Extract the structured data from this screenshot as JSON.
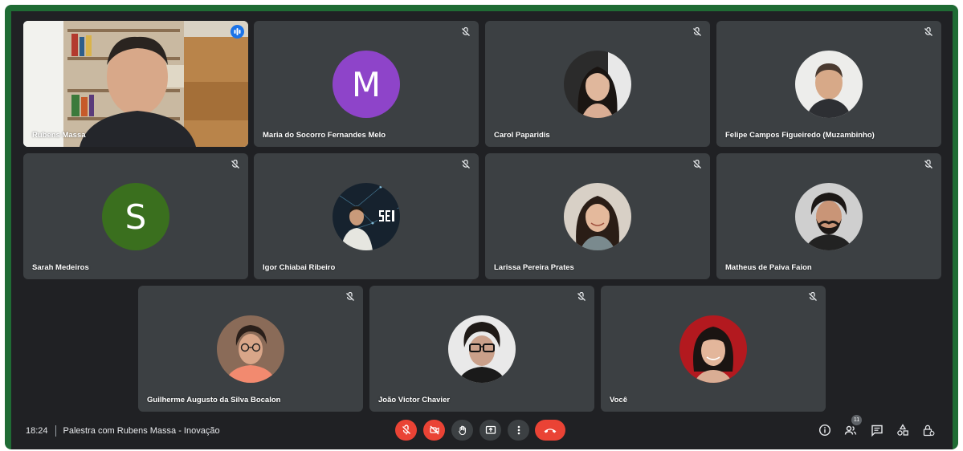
{
  "meeting": {
    "time": "18:24",
    "title": "Palestra com Rubens Massa - Inovação",
    "participant_count": "11"
  },
  "participants": [
    {
      "name": "Rubens Massa",
      "kind": "video",
      "speaking": true
    },
    {
      "name": "Maria do Socorro Fernandes Melo",
      "kind": "letter",
      "letter": "M",
      "color": "#8e44c9",
      "muted": true
    },
    {
      "name": "Carol Paparidis",
      "kind": "photo",
      "muted": true
    },
    {
      "name": "Felipe Campos Figueiredo (Muzambinho)",
      "kind": "photo",
      "muted": true
    },
    {
      "name": "Sarah Medeiros",
      "kind": "letter",
      "letter": "S",
      "color": "#3a6f1e",
      "muted": true
    },
    {
      "name": "Igor Chiabai Ribeiro",
      "kind": "photo",
      "muted": true
    },
    {
      "name": "Larissa Pereira Prates",
      "kind": "photo",
      "muted": true
    },
    {
      "name": "Matheus de Paiva Faion",
      "kind": "photo",
      "muted": true
    },
    {
      "name": "Guilherme Augusto da Silva Bocalon",
      "kind": "photo",
      "muted": true
    },
    {
      "name": "João Victor Chavier",
      "kind": "photo",
      "muted": true
    },
    {
      "name": "Você",
      "kind": "photo",
      "muted": true
    }
  ],
  "controls": {
    "mic": "mic-off-icon",
    "camera": "camera-off-icon",
    "raise_hand": "hand-icon",
    "present": "present-screen-icon",
    "more": "more-vert-icon",
    "leave": "hang-up-icon"
  },
  "right_controls": [
    "info-icon",
    "people-icon",
    "chat-icon",
    "activities-icon",
    "host-controls-icon"
  ],
  "colors": {
    "frame": "#1f6b34",
    "background": "#202124",
    "tile": "#3c4043",
    "danger": "#ea4335",
    "accent": "#1a73e8"
  }
}
